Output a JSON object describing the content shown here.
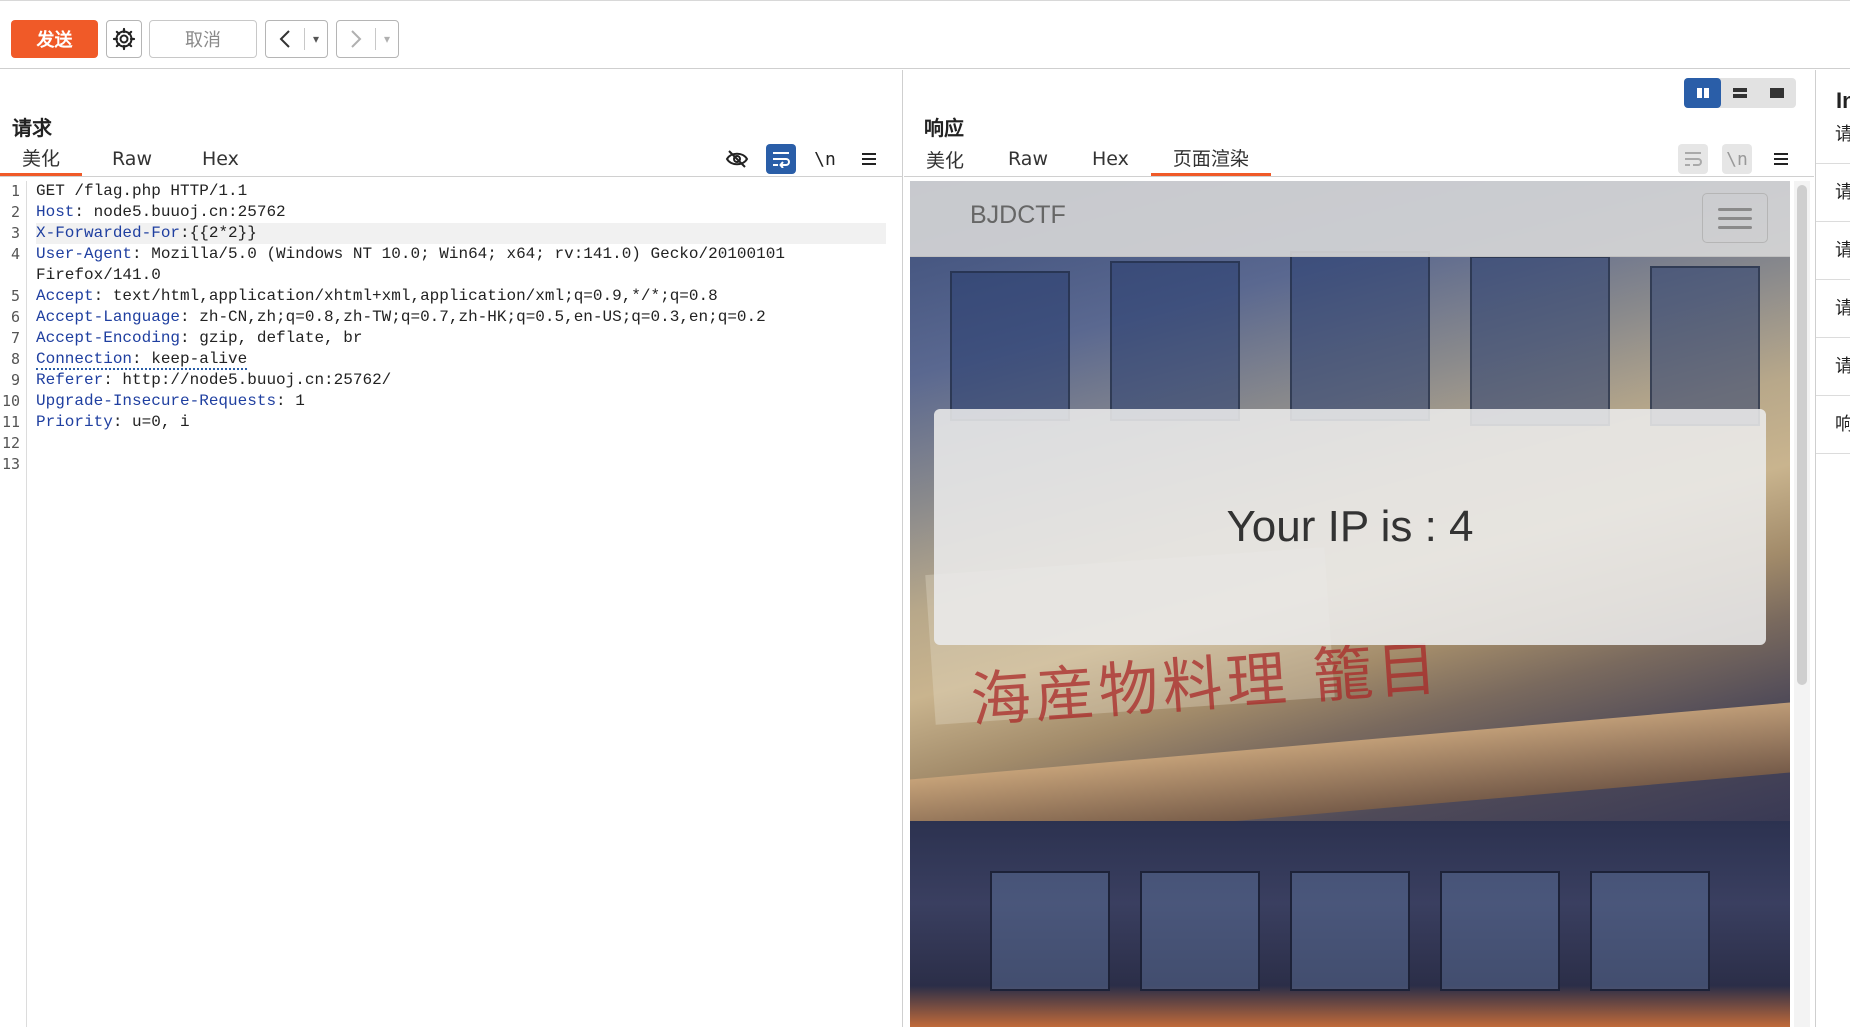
{
  "toolbar": {
    "send_label": "发送",
    "cancel_label": "取消",
    "back_arrow": "<",
    "forward_arrow": ">",
    "dropdown_glyph": "▾"
  },
  "request": {
    "title": "请求",
    "tabs": [
      "美化",
      "Raw",
      "Hex"
    ],
    "active_tab": "美化",
    "tools": [
      "eye-off-icon",
      "wrap-icon",
      "newline-toggle",
      "menu-icon"
    ],
    "newline_label": "\\n",
    "line_numbers": [
      "1",
      "2",
      "3",
      "4",
      "",
      "5",
      "6",
      "7",
      "8",
      "9",
      "10",
      "11",
      "12",
      "13"
    ],
    "lines": [
      {
        "key": "",
        "value": "GET /flag.php HTTP/1.1"
      },
      {
        "key": "Host",
        "value": ": node5.buuoj.cn:25762"
      },
      {
        "key": "X-Forwarded-For",
        "value": ":{{2*2}}"
      },
      {
        "key": "User-Agent",
        "value": ": Mozilla/5.0 (Windows NT 10.0; Win64; x64; rv:141.0) Gecko/20100101"
      },
      {
        "key": "",
        "value": "Firefox/141.0"
      },
      {
        "key": "Accept",
        "value": ": text/html,application/xhtml+xml,application/xml;q=0.9,*/*;q=0.8"
      },
      {
        "key": "Accept-Language",
        "value": ": zh-CN,zh;q=0.8,zh-TW;q=0.7,zh-HK;q=0.5,en-US;q=0.3,en;q=0.2"
      },
      {
        "key": "Accept-Encoding",
        "value": ": gzip, deflate, br"
      },
      {
        "key": "Connection",
        "value": ": keep-alive"
      },
      {
        "key": "Referer",
        "value": ": http://node5.buuoj.cn:25762/"
      },
      {
        "key": "Upgrade-Insecure-Requests",
        "value": ": 1"
      },
      {
        "key": "Priority",
        "value": ": u=0, i"
      },
      {
        "key": "",
        "value": ""
      },
      {
        "key": "",
        "value": ""
      }
    ]
  },
  "response": {
    "title": "响应",
    "tabs": [
      "美化",
      "Raw",
      "Hex",
      "页面渲染"
    ],
    "active_tab": "页面渲染",
    "newline_label": "\\n",
    "rendered_page": {
      "brand": "BJDCTF",
      "message": "Your IP is : 4",
      "sign_text": "海産物料理 籠目"
    }
  },
  "inspector": {
    "title": "In",
    "rows": [
      "请",
      "请",
      "请",
      "请",
      "请",
      "响"
    ]
  },
  "colors": {
    "accent": "#f05a28",
    "active_tool": "#2a5ea8",
    "header_key": "#1f3fa0"
  }
}
